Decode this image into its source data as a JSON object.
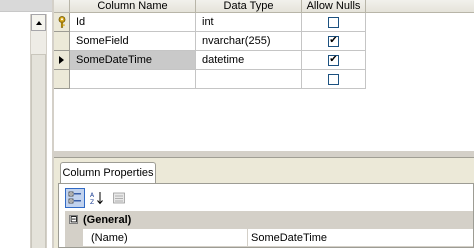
{
  "grid": {
    "headers": [
      "Column Name",
      "Data Type",
      "Allow Nulls"
    ],
    "rows": [
      {
        "name": "Id",
        "type": "int",
        "allow_nulls": false,
        "primary_key": true,
        "current": false
      },
      {
        "name": "SomeField",
        "type": "nvarchar(255)",
        "allow_nulls": true,
        "primary_key": false,
        "current": false
      },
      {
        "name": "SomeDateTime",
        "type": "datetime",
        "allow_nulls": true,
        "primary_key": false,
        "current": true
      },
      {
        "name": "",
        "type": "",
        "allow_nulls": false,
        "primary_key": false,
        "current": false
      }
    ]
  },
  "column_properties": {
    "tab_label": "Column Properties",
    "category": "(General)",
    "category_expander": "⊟",
    "properties": [
      {
        "name": "(Name)",
        "value": "SomeDateTime"
      }
    ]
  },
  "colors": {
    "selection_gray": "#c9c9c9",
    "panel_bg": "#ece9d8",
    "key_gold": "#d8a818"
  }
}
